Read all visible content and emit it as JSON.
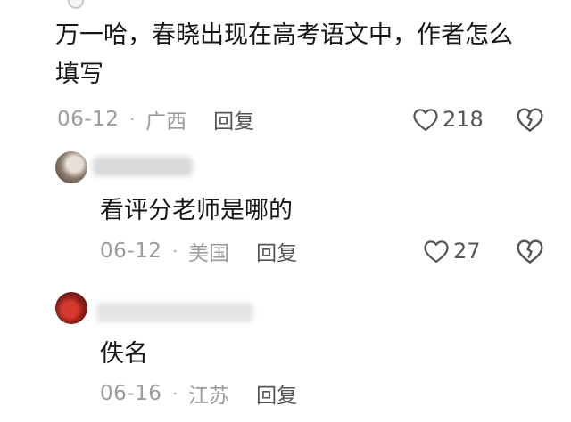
{
  "comments": [
    {
      "text": "万一哈，春晓出现在高考语文中，作者怎么\n填写",
      "date": "06-12",
      "separator": "·",
      "region": "广西",
      "reply_label": "回复",
      "likes": "218"
    },
    {
      "text": "看评分老师是哪的",
      "date": "06-12",
      "separator": "·",
      "region": "美国",
      "reply_label": "回复",
      "likes": "27"
    },
    {
      "text": "佚名",
      "date": "06-16",
      "separator": "·",
      "region": "江苏",
      "reply_label": "回复"
    }
  ],
  "icons": {
    "like": "heart-outline-icon",
    "dislike": "broken-heart-icon"
  },
  "colors": {
    "text": "#161616",
    "meta": "#9b9b9b",
    "action": "#555555"
  }
}
